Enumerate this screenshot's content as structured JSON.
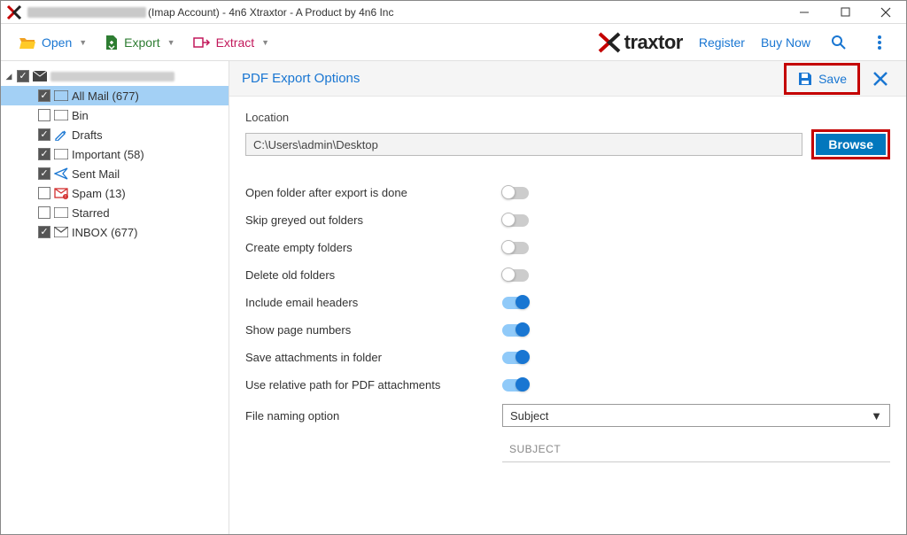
{
  "window": {
    "title_suffix": "(Imap Account) - 4n6 Xtraxtor - A Product by 4n6 Inc"
  },
  "toolbar": {
    "open": "Open",
    "export": "Export",
    "extract": "Extract",
    "brand": "traxtor",
    "register": "Register",
    "buy": "Buy Now"
  },
  "sidebar": {
    "items": [
      {
        "label": "All Mail",
        "count": "(677)",
        "checked": true,
        "selected": true,
        "icon": "folder"
      },
      {
        "label": "Bin",
        "count": "",
        "checked": false,
        "selected": false,
        "icon": "folder"
      },
      {
        "label": "Drafts",
        "count": "",
        "checked": true,
        "selected": false,
        "icon": "draft"
      },
      {
        "label": "Important",
        "count": "(58)",
        "checked": true,
        "selected": false,
        "icon": "folder"
      },
      {
        "label": "Sent Mail",
        "count": "",
        "checked": true,
        "selected": false,
        "icon": "sent"
      },
      {
        "label": "Spam",
        "count": "(13)",
        "checked": false,
        "selected": false,
        "icon": "spam"
      },
      {
        "label": "Starred",
        "count": "",
        "checked": false,
        "selected": false,
        "icon": "folder"
      },
      {
        "label": "INBOX",
        "count": "(677)",
        "checked": true,
        "selected": false,
        "icon": "inbox"
      }
    ]
  },
  "panel": {
    "title": "PDF Export Options",
    "save": "Save",
    "location_label": "Location",
    "location_value": "C:\\Users\\admin\\Desktop",
    "browse": "Browse",
    "options": [
      {
        "label": "Open folder after export is done",
        "on": false
      },
      {
        "label": "Skip greyed out folders",
        "on": false
      },
      {
        "label": "Create empty folders",
        "on": false
      },
      {
        "label": "Delete old folders",
        "on": false
      },
      {
        "label": "Include email headers",
        "on": true
      },
      {
        "label": "Show page numbers",
        "on": true
      },
      {
        "label": "Save attachments in folder",
        "on": true
      },
      {
        "label": "Use relative path for PDF attachments",
        "on": true
      }
    ],
    "naming_label": "File naming option",
    "naming_value": "Subject",
    "naming_preview": "SUBJECT"
  }
}
